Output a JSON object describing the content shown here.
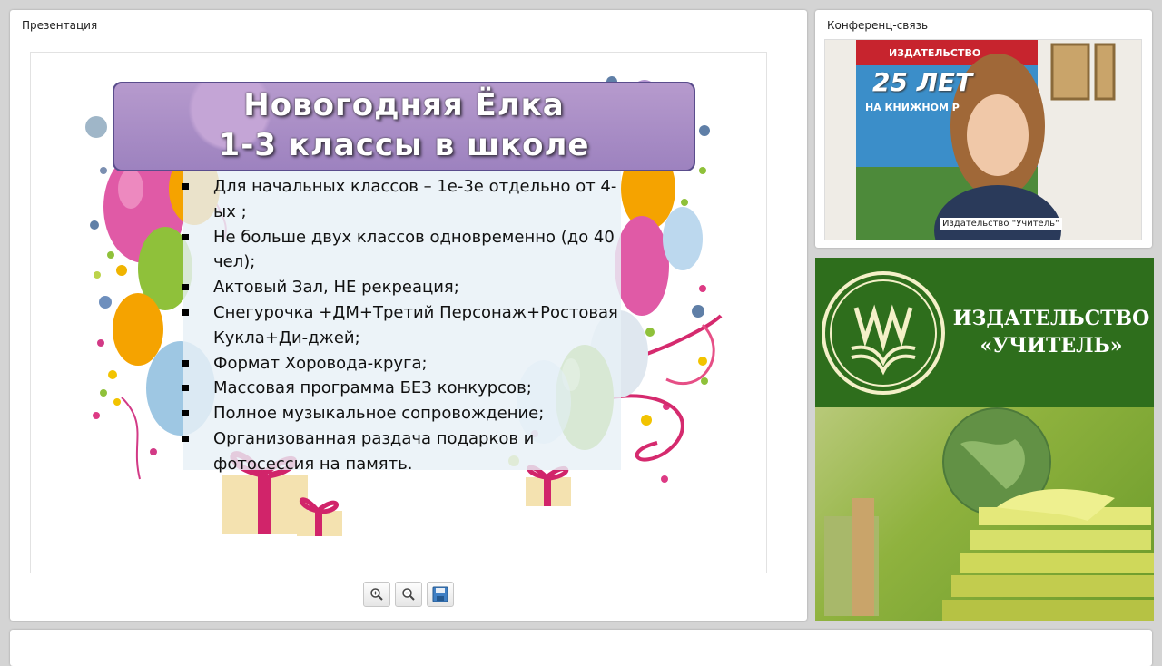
{
  "presentation": {
    "title": "Презентация",
    "slide": {
      "title_line1": "Новогодняя Ёлка",
      "title_line2": "1-3 классы в школе",
      "bullets": [
        "Для начальных классов – 1е-3е отдельно от 4-ых ;",
        "Не больше двух классов одновременно (до 40 чел);",
        "Актовый Зал, НЕ рекреация;",
        "Снегурочка +ДМ+Третий Персонаж+Ростовая Кукла+Ди-джей;",
        "Формат Хоровода-круга;",
        "Массовая программа БЕЗ конкурсов;",
        "Полное музыкальное сопровождение;",
        "Организованная раздача подарков и фотосессия на память."
      ]
    },
    "toolbar": {
      "zoom_in_icon": "zoom-in-icon",
      "zoom_out_icon": "zoom-out-icon",
      "save_icon": "save-icon"
    }
  },
  "conference": {
    "title": "Конференц-связь",
    "participant_name": "Издательство \"Учитель\"",
    "banner_text_line1": "25 ЛЕТ",
    "banner_text_line2": "НА КНИЖНОМ Р",
    "banner_top": "ИЗДАТЕЛЬСТВО"
  },
  "brand": {
    "line1": "ИЗДАТЕЛЬСТВО",
    "line2": "«УЧИТЕЛЬ»"
  },
  "colors": {
    "brand_green": "#2e6e1c",
    "title_purple": "#a88bc6"
  }
}
